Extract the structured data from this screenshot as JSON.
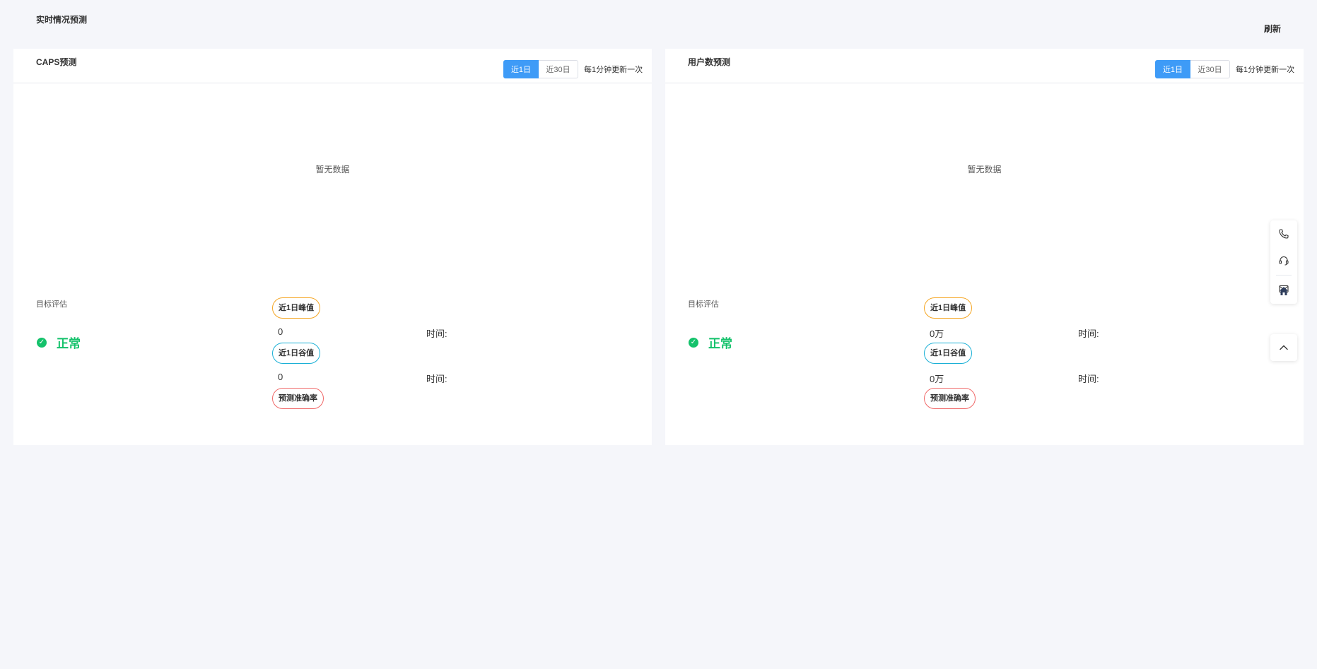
{
  "page": {
    "title": "实时情况预测",
    "refresh_label": "刷新"
  },
  "panels": [
    {
      "title": "CAPS预测",
      "toggle": {
        "active": "近1日",
        "inactive": "近30日"
      },
      "update_note": "每1分钟更新一次",
      "empty_text": "暂无数据",
      "eval_label": "目标评估",
      "status": "正常",
      "peak_tag": "近1日峰值",
      "peak_value": "0",
      "peak_time_label": "时间:",
      "valley_tag": "近1日谷值",
      "valley_value": "0",
      "valley_time_label": "时间:",
      "accuracy_tag": "预测准确率"
    },
    {
      "title": "用户数预测",
      "toggle": {
        "active": "近1日",
        "inactive": "近30日"
      },
      "update_note": "每1分钟更新一次",
      "empty_text": "暂无数据",
      "eval_label": "目标评估",
      "status": "正常",
      "peak_tag": "近1日峰值",
      "peak_value": "0万",
      "peak_time_label": "时间:",
      "valley_tag": "近1日谷值",
      "valley_value": "0万",
      "valley_time_label": "时间:",
      "accuracy_tag": "预测准确率"
    }
  ],
  "float_bar": {
    "icons": [
      "phone-icon",
      "headset-icon",
      "mail-icon",
      "home-icon"
    ],
    "back_top_icon": "chevron-up-icon"
  },
  "colors": {
    "accent": "#3e9bf7",
    "success": "#14c26b",
    "peak_border": "#f5a623",
    "valley_border": "#1ab0d6",
    "accuracy_border": "#f06a6a"
  }
}
